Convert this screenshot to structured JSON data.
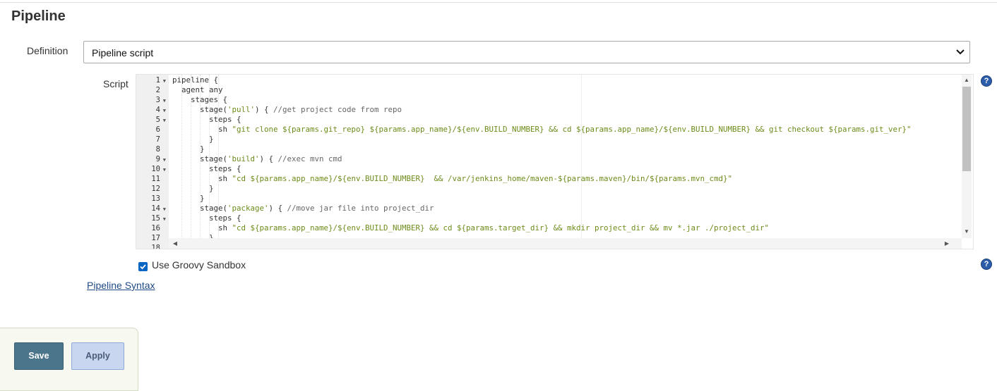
{
  "section": {
    "title": "Pipeline"
  },
  "definition": {
    "label": "Definition",
    "selected": "Pipeline script"
  },
  "script": {
    "label": "Script",
    "line_numbers": [
      "1",
      "2",
      "3",
      "4",
      "5",
      "6",
      "7",
      "8",
      "9",
      "10",
      "11",
      "12",
      "13",
      "14",
      "15",
      "16",
      "17",
      "18"
    ],
    "folds": [
      "1",
      "3",
      "4",
      "5",
      "9",
      "10",
      "14",
      "15"
    ],
    "lines": [
      [
        [
          "t",
          "pipeline {"
        ]
      ],
      [
        [
          "t",
          "  agent any"
        ]
      ],
      [
        [
          "t",
          "    stages {"
        ]
      ],
      [
        [
          "t",
          "      stage("
        ],
        [
          "s",
          "'pull'"
        ],
        [
          "t",
          ") { "
        ],
        [
          "c",
          "//get project code from repo"
        ]
      ],
      [
        [
          "t",
          "        steps {"
        ]
      ],
      [
        [
          "t",
          "          sh "
        ],
        [
          "s",
          "\"git clone ${params.git_repo} ${params.app_name}/${env.BUILD_NUMBER} && cd ${params.app_name}/${env.BUILD_NUMBER} && git checkout ${params.git_ver}\""
        ]
      ],
      [
        [
          "t",
          "        }"
        ]
      ],
      [
        [
          "t",
          "      }"
        ]
      ],
      [
        [
          "t",
          "      stage("
        ],
        [
          "s",
          "'build'"
        ],
        [
          "t",
          ") { "
        ],
        [
          "c",
          "//exec mvn cmd"
        ]
      ],
      [
        [
          "t",
          "        steps {"
        ]
      ],
      [
        [
          "t",
          "          sh "
        ],
        [
          "s",
          "\"cd ${params.app_name}/${env.BUILD_NUMBER}  && /var/jenkins_home/maven-${params.maven}/bin/${params.mvn_cmd}\""
        ]
      ],
      [
        [
          "t",
          "        }"
        ]
      ],
      [
        [
          "t",
          "      }"
        ]
      ],
      [
        [
          "t",
          "      stage("
        ],
        [
          "s",
          "'package'"
        ],
        [
          "t",
          ") { "
        ],
        [
          "c",
          "//move jar file into project_dir"
        ]
      ],
      [
        [
          "t",
          "        steps {"
        ]
      ],
      [
        [
          "t",
          "          sh "
        ],
        [
          "s",
          "\"cd ${params.app_name}/${env.BUILD_NUMBER} && cd ${params.target_dir} && mkdir project_dir && mv *.jar ./project_dir\""
        ]
      ],
      [
        [
          "t",
          "        }"
        ]
      ]
    ]
  },
  "sandbox": {
    "label": "Use Groovy Sandbox",
    "checked": true
  },
  "syntax_link": "Pipeline Syntax",
  "buttons": {
    "save": "Save",
    "apply": "Apply"
  },
  "icons": {
    "help": "help-icon",
    "checkbox": "checkmark-icon",
    "select": "chevron-down-icon"
  },
  "colors": {
    "save_bg": "#4b758b",
    "apply_bg": "#c8d6ef",
    "help": "#2c5dab",
    "string": "#6d8b1a"
  }
}
